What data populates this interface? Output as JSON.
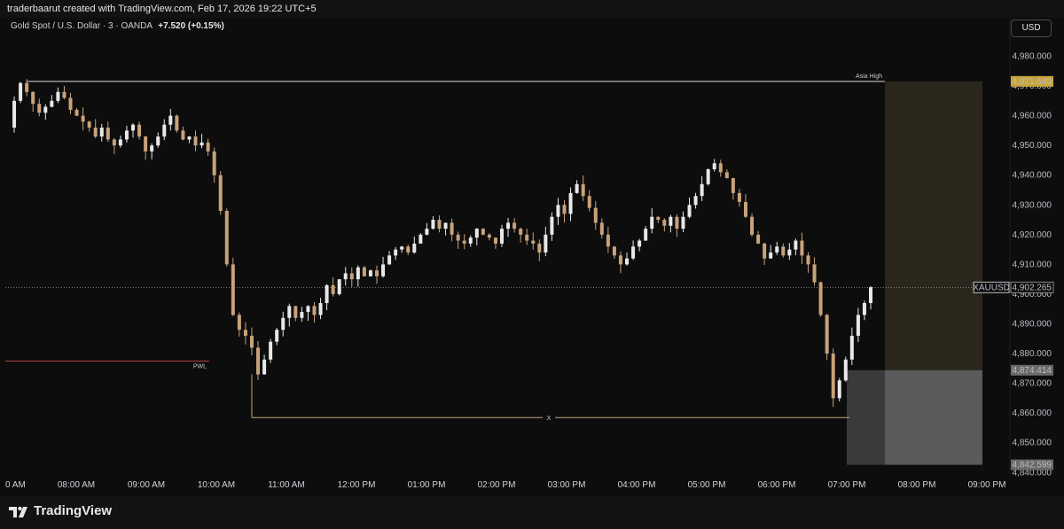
{
  "header": {
    "attribution": "traderbaarut created with TradingView.com, Feb 17, 2026 19:22 UTC+5"
  },
  "legend": {
    "symbol_text": "Gold Spot / U.S. Dollar · 3 · OANDA",
    "change": "+7.520 (+0.15%)"
  },
  "currency_button": "USD",
  "footer": {
    "logo_text": "TradingView"
  },
  "colors": {
    "background": "#0d0d0d",
    "candle_up": "#e8e8e8",
    "candle_down": "#c9a27a",
    "pwl_line": "#b5423f",
    "target_zone": "#2b261c",
    "stop_zone": "#3a3a3a"
  },
  "chart_data": {
    "type": "candlestick",
    "title": "",
    "xlabel": "",
    "ylabel": "",
    "ylim": [
      4838,
      4987
    ],
    "y_ticks": [
      "4,980.000",
      "4,970.000",
      "4,960.000",
      "4,950.000",
      "4,940.000",
      "4,930.000",
      "4,920.000",
      "4,910.000",
      "4,900.000",
      "4,890.000",
      "4,880.000",
      "4,870.000",
      "4,860.000",
      "4,850.000",
      "4,840.000"
    ],
    "x_ticks": [
      "0 AM",
      "08:00 AM",
      "09:00 AM",
      "10:00 AM",
      "11:00 AM",
      "12:00 PM",
      "01:00 PM",
      "02:00 PM",
      "03:00 PM",
      "04:00 PM",
      "05:00 PM",
      "06:00 PM",
      "07:00 PM",
      "08:00 PM",
      "09:00 PM"
    ],
    "price_labels": {
      "asia_high": "4,971.549",
      "current": "4,902.265",
      "current_symbol": "XAUUSD",
      "stop": "4,874.414",
      "bottom": "4,842.599"
    },
    "annotations": {
      "asia_high_label": "Asia High",
      "pwl_label": "PWL",
      "x_label": "X"
    },
    "levels": {
      "asia_high": 4971.549,
      "current": 4902.265,
      "stop": 4874.414,
      "bottom": 4842.599,
      "pwl": 4877.5,
      "x_line": 4858.5
    },
    "grid": false,
    "close_path": [
      4956,
      4965,
      4971,
      4968,
      4964,
      4961,
      4963,
      4965,
      4968,
      4966,
      4962,
      4960,
      4958,
      4956,
      4953,
      4956,
      4952,
      4950,
      4952,
      4955,
      4957,
      4953,
      4948,
      4950,
      4953,
      4957,
      4960,
      4955,
      4952,
      4953,
      4950,
      4951,
      4948,
      4940,
      4928,
      4910,
      4893,
      4888,
      4886,
      4882,
      4873,
      4878,
      4884,
      4888,
      4892,
      4896,
      4892,
      4894,
      4896,
      4893,
      4897,
      4903,
      4900,
      4905,
      4907,
      4905,
      4909,
      4906,
      4908,
      4906,
      4910,
      4913,
      4915,
      4916,
      4914,
      4917,
      4920,
      4922,
      4925,
      4922,
      4924,
      4920,
      4918,
      4917,
      4919,
      4922,
      4920,
      4919,
      4917,
      4922,
      4924,
      4922,
      4920,
      4918,
      4917,
      4914,
      4920,
      4926,
      4930,
      4927,
      4934,
      4937,
      4933,
      4929,
      4924,
      4920,
      4916,
      4913,
      4910,
      4912,
      4916,
      4918,
      4922,
      4926,
      4925,
      4923,
      4926,
      4922,
      4926,
      4930,
      4933,
      4937,
      4942,
      4944,
      4941,
      4939,
      4934,
      4931,
      4926,
      4920,
      4917,
      4912,
      4914,
      4916,
      4913,
      4915,
      4918,
      4913,
      4910,
      4904,
      4893,
      4880,
      4865,
      4871,
      4878,
      4886,
      4893,
      4897,
      4902.3
    ],
    "note": "close_path is a sequence of approximate 3-minute closes read from the chart"
  }
}
